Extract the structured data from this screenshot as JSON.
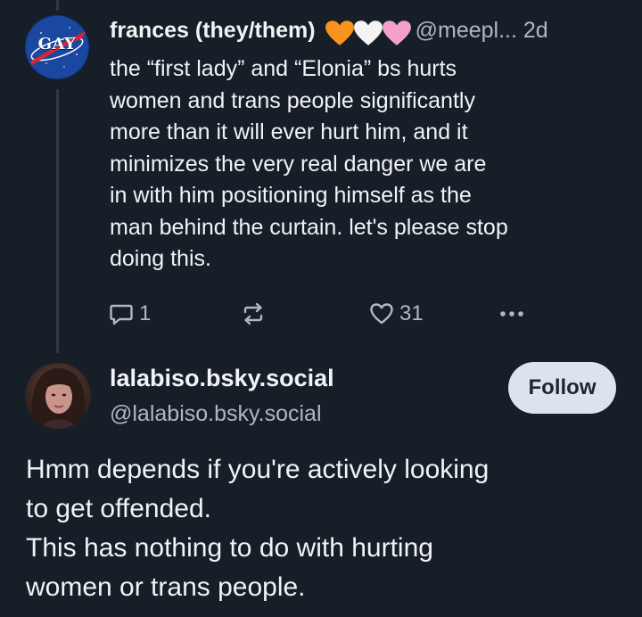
{
  "parent_post": {
    "avatar": {
      "logo_text": "GAY",
      "icon": "nasa-style-logo-icon"
    },
    "author_name": "frances (they/them)",
    "hearts": [
      {
        "icon": "orange-heart-icon",
        "color": "#f7931e"
      },
      {
        "icon": "white-heart-icon",
        "color": "#f4f4f4"
      },
      {
        "icon": "pink-heart-icon",
        "color": "#f5a0c8"
      }
    ],
    "handle": "@meepl...",
    "time": "2d",
    "text_lines": [
      "the “first lady” and “Elonia” bs hurts",
      "women and trans people significantly",
      "more than it will ever hurt him, and it",
      "minimizes the very real danger we are",
      "in with him positioning himself as the",
      "man behind the curtain. let's please stop",
      "doing this."
    ],
    "actions": {
      "reply_count": "1",
      "repost_count": "",
      "like_count": "31"
    }
  },
  "reply_post": {
    "author_name": "lalabiso.bsky.social",
    "handle": "@lalabiso.bsky.social",
    "follow_label": "Follow",
    "text_lines": [
      "Hmm depends if you're actively looking",
      "to get offended.",
      "This has nothing to do with hurting",
      "women or trans people."
    ]
  },
  "colors": {
    "background": "#161e27",
    "text_primary": "#f1f3f5",
    "text_secondary": "#aeb8c4",
    "thread_line": "#2e3a48",
    "follow_button_bg": "#dbe3ec"
  }
}
